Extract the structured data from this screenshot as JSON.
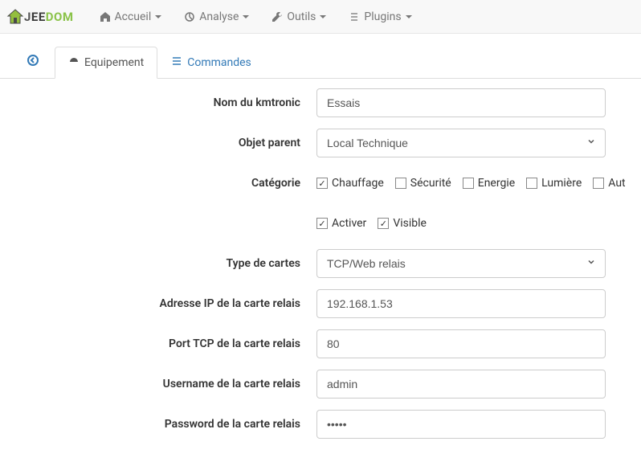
{
  "logo": {
    "prefix": "J",
    "mid": "EE",
    "suffix": "DOM"
  },
  "nav": {
    "home": "Accueil",
    "analyse": "Analyse",
    "outils": "Outils",
    "plugins": "Plugins"
  },
  "tabs": {
    "equip": "Equipement",
    "commandes": "Commandes"
  },
  "labels": {
    "nom": "Nom du kmtronic",
    "parent": "Objet parent",
    "categorie": "Catégorie",
    "type_cartes": "Type de cartes",
    "ip": "Adresse IP de la carte relais",
    "port": "Port TCP de la carte relais",
    "user": "Username de la carte relais",
    "pass": "Password de la carte relais"
  },
  "values": {
    "nom": "Essais",
    "parent": "Local Technique",
    "type_cartes": "TCP/Web relais",
    "ip": "192.168.1.53",
    "port": "80",
    "user": "admin",
    "pass": "•••••"
  },
  "categories": [
    {
      "key": "chauffage",
      "label": "Chauffage",
      "checked": true
    },
    {
      "key": "securite",
      "label": "Sécurité",
      "checked": false
    },
    {
      "key": "energie",
      "label": "Energie",
      "checked": false
    },
    {
      "key": "lumiere",
      "label": "Lumière",
      "checked": false
    },
    {
      "key": "autre",
      "label": "Aut",
      "checked": false
    }
  ],
  "flags": {
    "activer": {
      "label": "Activer",
      "checked": true
    },
    "visible": {
      "label": "Visible",
      "checked": true
    }
  }
}
